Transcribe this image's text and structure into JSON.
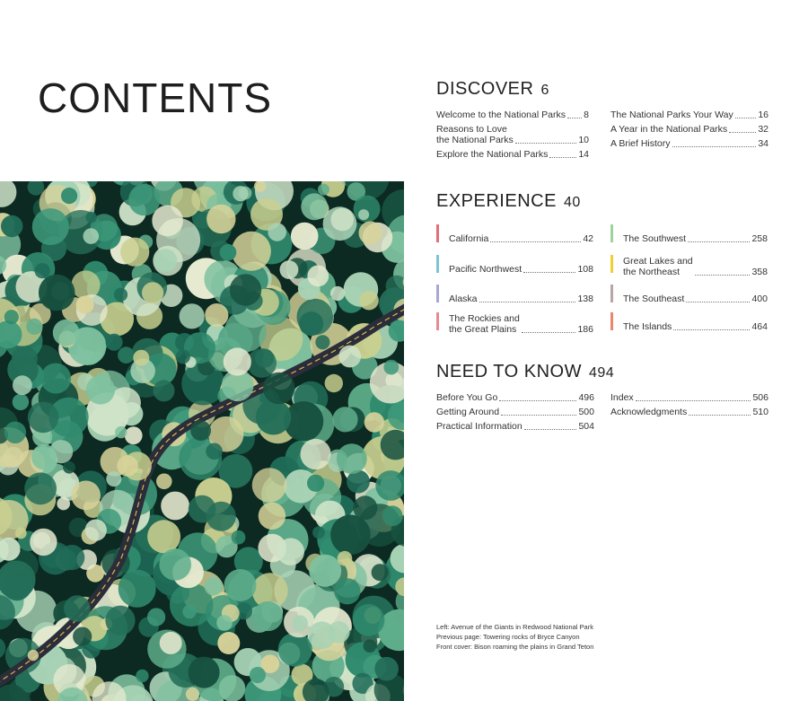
{
  "title": "CONTENTS",
  "photo": {
    "name": "aerial-forest-road"
  },
  "sections": {
    "discover": {
      "title": "DISCOVER",
      "page": "6",
      "left": [
        {
          "title": "Welcome to the National Parks",
          "page": "8"
        },
        {
          "title": "Reasons to Love\nthe National Parks",
          "page": "10"
        },
        {
          "title": "Explore the National Parks",
          "page": "14"
        }
      ],
      "right": [
        {
          "title": "The National Parks Your Way",
          "page": "16"
        },
        {
          "title": "A Year in the National Parks",
          "page": "32"
        },
        {
          "title": "A Brief History",
          "page": "34"
        }
      ]
    },
    "experience": {
      "title": "EXPERIENCE",
      "page": "40",
      "left": [
        {
          "title": "California",
          "page": "42",
          "color": "#e06f7a"
        },
        {
          "title": "Pacific Northwest",
          "page": "108",
          "color": "#7cc4d4"
        },
        {
          "title": "Alaska",
          "page": "138",
          "color": "#a9a6d6"
        },
        {
          "title": "The Rockies and\nthe Great Plains",
          "page": "186",
          "color": "#e58a97"
        }
      ],
      "right": [
        {
          "title": "The Southwest",
          "page": "258",
          "color": "#9fd39a"
        },
        {
          "title": "Great Lakes and\nthe Northeast",
          "page": "358",
          "color": "#f2cf2f"
        },
        {
          "title": "The Southeast",
          "page": "400",
          "color": "#b7a5a7"
        },
        {
          "title": "The Islands",
          "page": "464",
          "color": "#e9866f"
        }
      ]
    },
    "need_to_know": {
      "title": "NEED TO KNOW",
      "page": "494",
      "left": [
        {
          "title": "Before You Go",
          "page": "496"
        },
        {
          "title": "Getting Around",
          "page": "500"
        },
        {
          "title": "Practical Information",
          "page": "504"
        }
      ],
      "right": [
        {
          "title": "Index",
          "page": "506"
        },
        {
          "title": "Acknowledgments",
          "page": "510"
        }
      ]
    }
  },
  "captions": [
    "Left: Avenue of the Giants in Redwood National Park",
    "Previous page: Towering rocks of Bryce Canyon",
    "Front cover: Bison roaming the plains in Grand Teton"
  ]
}
